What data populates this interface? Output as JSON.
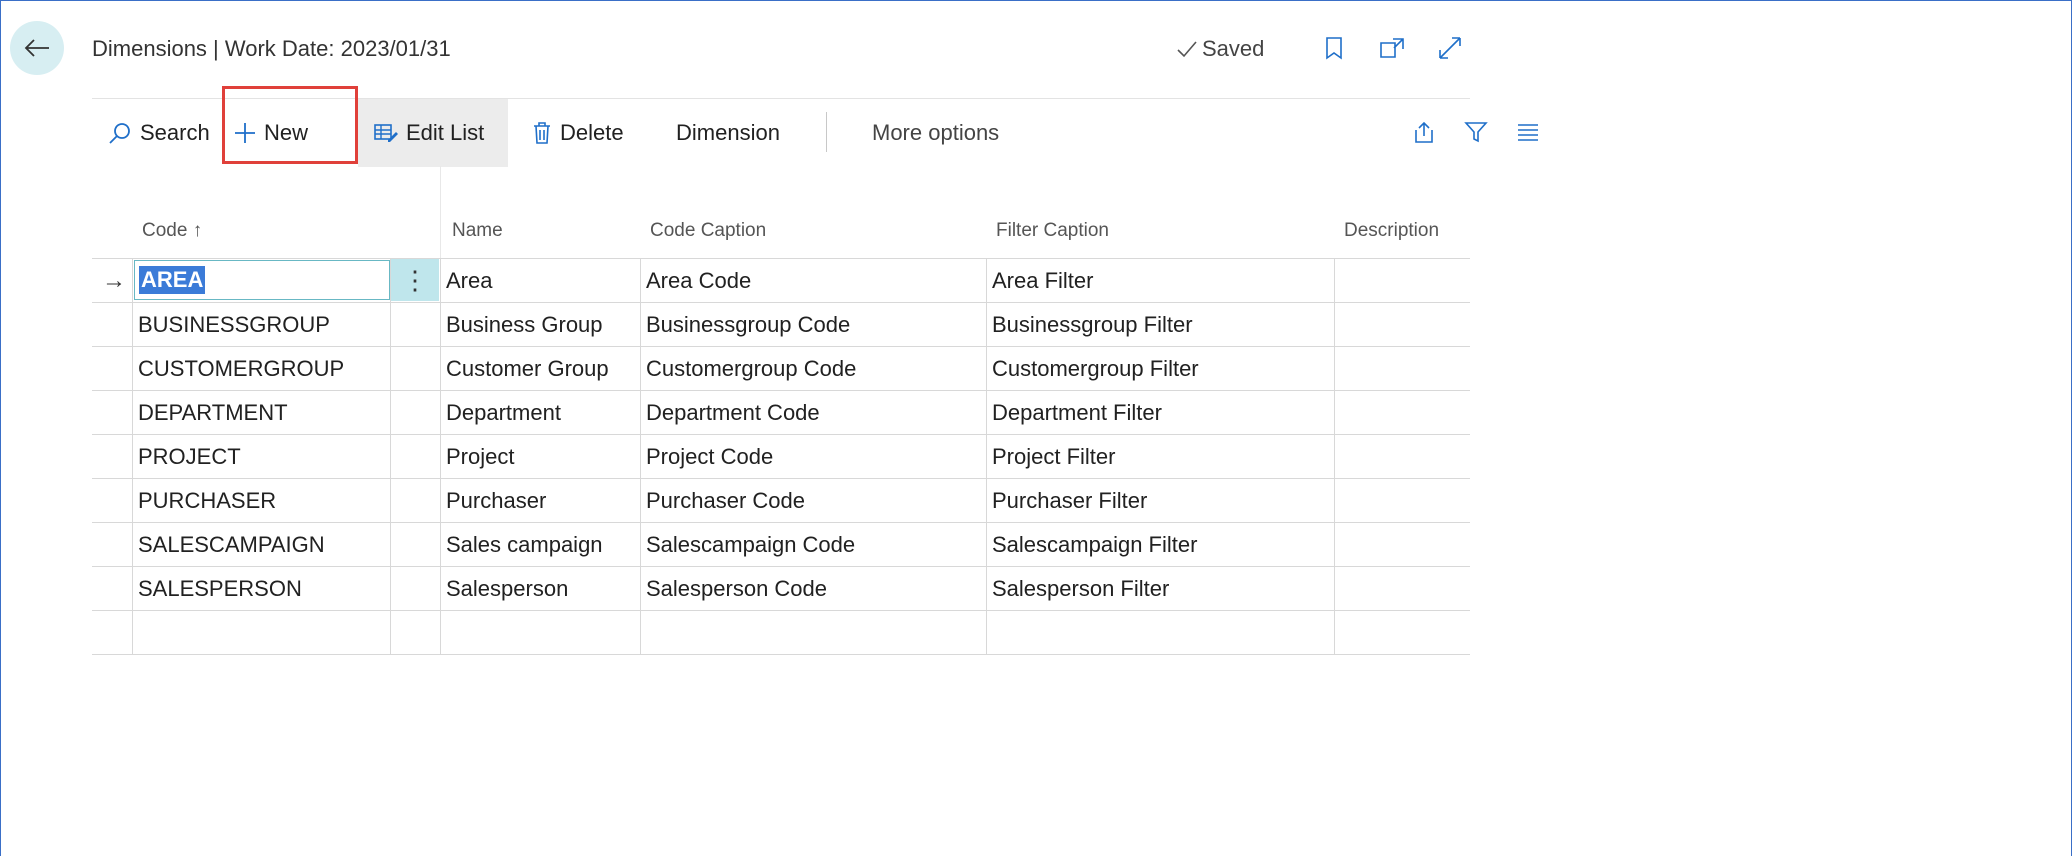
{
  "header": {
    "title": "Dimensions | Work Date: 2023/01/31",
    "saved_label": "Saved"
  },
  "actions": {
    "search": "Search",
    "new": "New",
    "edit_list": "Edit List",
    "delete": "Delete",
    "dimension": "Dimension",
    "more_options": "More options"
  },
  "table": {
    "columns": {
      "code": "Code ↑",
      "name": "Name",
      "code_caption": "Code Caption",
      "filter_caption": "Filter Caption",
      "description": "Description"
    },
    "rows": [
      {
        "code": "AREA",
        "name": "Area",
        "code_caption": "Area Code",
        "filter_caption": "Area Filter",
        "description": ""
      },
      {
        "code": "BUSINESSGROUP",
        "name": "Business Group",
        "code_caption": "Businessgroup Code",
        "filter_caption": "Businessgroup Filter",
        "description": ""
      },
      {
        "code": "CUSTOMERGROUP",
        "name": "Customer Group",
        "code_caption": "Customergroup Code",
        "filter_caption": "Customergroup Filter",
        "description": ""
      },
      {
        "code": "DEPARTMENT",
        "name": "Department",
        "code_caption": "Department Code",
        "filter_caption": "Department Filter",
        "description": ""
      },
      {
        "code": "PROJECT",
        "name": "Project",
        "code_caption": "Project Code",
        "filter_caption": "Project Filter",
        "description": ""
      },
      {
        "code": "PURCHASER",
        "name": "Purchaser",
        "code_caption": "Purchaser Code",
        "filter_caption": "Purchaser Filter",
        "description": ""
      },
      {
        "code": "SALESCAMPAIGN",
        "name": "Sales campaign",
        "code_caption": "Salescampaign Code",
        "filter_caption": "Salescampaign Filter",
        "description": ""
      },
      {
        "code": "SALESPERSON",
        "name": "Salesperson",
        "code_caption": "Salesperson Code",
        "filter_caption": "Salesperson Filter",
        "description": ""
      }
    ],
    "selected_row_indicator": "→",
    "row_menu_glyph": "⋮"
  },
  "colors": {
    "accent": "#3b7bd8",
    "selection_bg": "#bfe6ec",
    "highlight_border": "#e0403a",
    "back_button_bg": "#d7eef2"
  }
}
